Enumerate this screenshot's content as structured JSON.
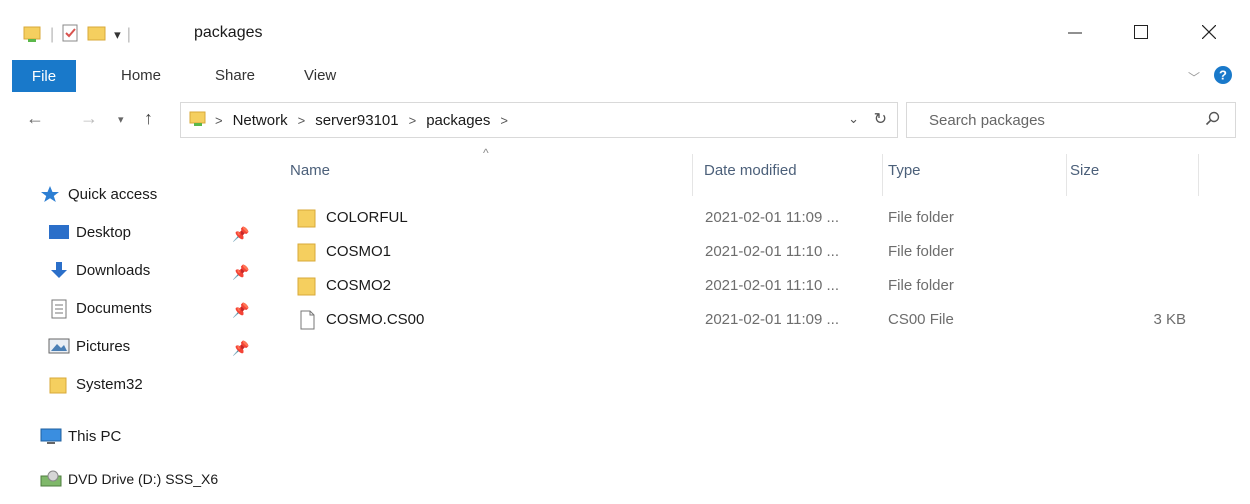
{
  "window": {
    "title": "packages",
    "controls": {
      "minimize": "minimize-icon",
      "maximize": "maximize-icon",
      "close": "close-icon"
    }
  },
  "ribbon": {
    "tabs": [
      {
        "label": "File",
        "active": true
      },
      {
        "label": "Home"
      },
      {
        "label": "Share"
      },
      {
        "label": "View"
      }
    ]
  },
  "address": {
    "breadcrumbs": [
      "Network",
      "server93101",
      "packages"
    ]
  },
  "search": {
    "placeholder": "Search packages"
  },
  "nav_pane": {
    "items": [
      {
        "label": "Quick access",
        "icon": "star-icon",
        "pinned": false
      },
      {
        "label": "Desktop",
        "icon": "desktop-icon",
        "pinned": true
      },
      {
        "label": "Downloads",
        "icon": "download-icon",
        "pinned": true
      },
      {
        "label": "Documents",
        "icon": "documents-icon",
        "pinned": true
      },
      {
        "label": "Pictures",
        "icon": "pictures-icon",
        "pinned": true
      },
      {
        "label": "System32",
        "icon": "folder-icon",
        "pinned": false
      },
      {
        "label": "This PC",
        "icon": "computer-icon",
        "pinned": false
      },
      {
        "label": "DVD Drive (D:) SSS_X6",
        "icon": "dvd-icon",
        "pinned": false
      }
    ]
  },
  "file_list": {
    "columns": [
      "Name",
      "Date modified",
      "Type",
      "Size"
    ],
    "rows": [
      {
        "name": "COLORFUL",
        "date": "2021-02-01 11:09 ...",
        "type": "File folder",
        "size": "",
        "icon": "folder-icon"
      },
      {
        "name": "COSMO1",
        "date": "2021-02-01 11:10 ...",
        "type": "File folder",
        "size": "",
        "icon": "folder-icon"
      },
      {
        "name": "COSMO2",
        "date": "2021-02-01 11:10 ...",
        "type": "File folder",
        "size": "",
        "icon": "folder-icon"
      },
      {
        "name": "COSMO.CS00",
        "date": "2021-02-01 11:09 ...",
        "type": "CS00 File",
        "size": "3 KB",
        "icon": "file-icon"
      }
    ]
  },
  "colors": {
    "accent": "#1979ca",
    "folder": "#f5cf5f",
    "header_text": "#4c607a"
  }
}
